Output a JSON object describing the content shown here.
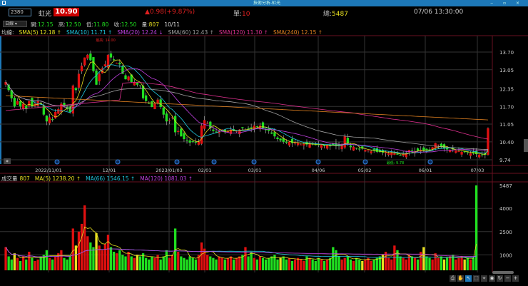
{
  "window": {
    "title": "技術分析-虹光",
    "controls": "‒ ▫ ×"
  },
  "quote": {
    "code": "2380",
    "name": "虹光",
    "price": "10.90",
    "change": "▲0.98(+9.87%)",
    "unit_label": "單:",
    "unit_value": "10",
    "total_label": "總:",
    "total_value": "5487",
    "time": "07/06 13:30:00"
  },
  "bar_info": {
    "period": "日線",
    "open_label": "開:",
    "open": "12.15",
    "high_label": "高:",
    "high": "12.50",
    "low_label": "低:",
    "low": "11.80",
    "close_label": "收:",
    "close": "12.50",
    "vol_label": "量:",
    "vol": "807",
    "date": "10/11"
  },
  "ma_legend": {
    "label": "均線:",
    "items": [
      {
        "text": "SMA(5) 12.18 ↑",
        "color": "#e8e020"
      },
      {
        "text": "SMA(10) 11.71 ↑",
        "color": "#20c8e0"
      },
      {
        "text": "SMA(20) 12.24 ↓",
        "color": "#c040e0"
      },
      {
        "text": "SMA(60) 12.43 ↑",
        "color": "#a0a0a0"
      },
      {
        "text": "SMA(120) 11.30 ↑",
        "color": "#e03090"
      },
      {
        "text": "SMA(240) 12.15 ↑",
        "color": "#e08020"
      }
    ]
  },
  "vol_legend": {
    "label": "成交量",
    "value": "807",
    "items": [
      {
        "text": "MA(5) 1238.20 ↑",
        "color": "#e8e020"
      },
      {
        "text": "MA(66) 1546.15 ↑",
        "color": "#20c8e0"
      },
      {
        "text": "MA(120) 1081.03 ↑",
        "color": "#c040e0"
      }
    ]
  },
  "price_axis": [
    "13.70",
    "13.05",
    "12.35",
    "11.70",
    "11.05",
    "10.40",
    "9.74"
  ],
  "volume_axis": [
    "5487",
    "4000",
    "2500",
    "1000"
  ],
  "date_axis": [
    "2022/11/01",
    "12/01",
    "2023/01/03",
    "02/01",
    "03/01",
    "04/06",
    "05/02",
    "06/01",
    "07/03"
  ],
  "annotations": {
    "high": "最高: 14.00",
    "low": "最低: 9.78"
  },
  "colors": {
    "up": "#e01010",
    "down": "#20e020",
    "grid": "#333",
    "frame": "#6a1020"
  },
  "chart_data": {
    "type": "candlestick",
    "ylim": [
      9.74,
      13.7
    ],
    "volume_max": 5487,
    "closes": [
      12.6,
      12.3,
      12.0,
      11.7,
      11.9,
      11.7,
      11.8,
      11.6,
      11.9,
      11.7,
      11.8,
      11.9,
      11.8,
      11.4,
      11.15,
      11.3,
      11.2,
      11.5,
      11.6,
      11.8,
      11.7,
      11.6,
      11.5,
      12.47,
      12.3,
      12.9,
      13.2,
      13.5,
      13.6,
      13.4,
      13.0,
      12.5,
      12.9,
      13.1,
      13.25,
      13.6,
      13.5,
      13.4,
      13.3,
      13.25,
      12.9,
      12.7,
      12.8,
      12.6,
      12.6,
      12.5,
      12.47,
      12.0,
      11.9,
      11.8,
      11.68,
      11.8,
      11.95,
      11.68,
      11.4,
      11.15,
      11.2,
      11.3,
      10.75,
      10.8,
      10.6,
      10.5,
      10.45,
      10.37,
      10.4,
      10.38,
      10.4,
      11.0,
      11.2,
      11.1,
      10.9,
      10.8,
      10.75,
      10.8,
      10.85,
      10.75,
      10.8,
      10.85,
      10.8,
      10.8,
      10.85,
      10.9,
      10.85,
      10.9,
      10.9,
      11.0,
      10.95,
      11.0,
      10.9,
      10.85,
      10.8,
      10.7,
      10.6,
      10.5,
      10.45,
      10.4,
      10.37,
      10.4,
      10.35,
      10.38,
      10.35,
      10.3,
      10.32,
      10.3,
      10.35,
      10.3,
      10.3,
      10.28,
      10.3,
      10.25,
      10.28,
      10.25,
      10.27,
      10.25,
      10.25,
      10.3,
      10.6,
      10.35,
      10.2,
      10.22,
      10.15,
      10.12,
      10.15,
      10.1,
      10.08,
      10.05,
      10.07,
      10.03,
      10.03,
      10.0,
      10.02,
      9.98,
      10.0,
      9.97,
      9.93,
      9.9,
      9.95,
      10.0,
      10.1,
      10.08,
      10.05,
      10.08,
      10.1,
      10.07,
      10.1,
      10.1,
      10.2,
      10.35,
      10.3,
      10.2,
      10.15,
      10.12,
      10.1,
      10.12,
      10.08,
      10.05,
      10.03,
      10.02,
      10.0,
      9.98,
      9.97,
      9.95,
      9.93,
      9.92,
      9.92,
      10.9
    ],
    "volumes": [
      1500,
      900,
      700,
      1100,
      800,
      600,
      900,
      700,
      1200,
      800,
      600,
      700,
      900,
      1000,
      1300,
      800,
      700,
      900,
      1100,
      1300,
      800,
      700,
      900,
      2700,
      1600,
      2500,
      3000,
      4200,
      2200,
      1800,
      1500,
      2400,
      1600,
      1300,
      1700,
      2300,
      1500,
      1200,
      1100,
      1300,
      1000,
      900,
      1200,
      900,
      800,
      1000,
      900,
      1100,
      800,
      700,
      900,
      800,
      1000,
      700,
      900,
      1300,
      800,
      1000,
      2700,
      1200,
      900,
      800,
      700,
      900,
      800,
      700,
      1000,
      1800,
      1400,
      1000,
      900,
      800,
      700,
      900,
      800,
      700,
      800,
      900,
      700,
      800,
      900,
      1000,
      1500,
      900,
      1200,
      800,
      700,
      900,
      800,
      700,
      800,
      900,
      1000,
      700,
      800,
      900,
      700,
      800,
      600,
      700,
      800,
      700,
      600,
      900,
      800,
      700,
      600,
      800,
      700,
      600,
      700,
      800,
      1500,
      1300,
      900,
      700,
      800,
      900,
      700,
      600,
      800,
      700,
      600,
      700,
      800,
      600,
      700,
      800,
      900,
      1000,
      1200,
      800,
      700,
      1600,
      1300,
      900,
      800,
      700,
      1000,
      900,
      800,
      700,
      1200,
      1500,
      900,
      800,
      700,
      1100,
      800,
      900,
      700,
      800,
      900,
      1000,
      700,
      800,
      900,
      700,
      800,
      700,
      800,
      5487
    ]
  }
}
